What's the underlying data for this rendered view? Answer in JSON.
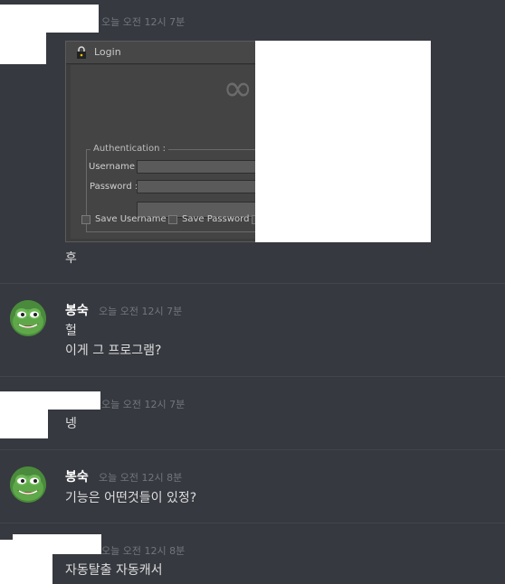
{
  "messages": [
    {
      "timestamp": "오늘 오전 12시 7분",
      "attachment": {
        "window_title": "Login",
        "logo_glyph": "∞",
        "group_label": "Authentication :",
        "username_label": "Username :",
        "password_label": "Password :",
        "checkboxes": [
          "Save Username",
          "Save Password"
        ]
      },
      "lines": [
        "후"
      ]
    },
    {
      "author": "봉숙",
      "timestamp": "오늘 오전 12시 7분",
      "lines": [
        "헐",
        "이게 그 프로그램?"
      ]
    },
    {
      "timestamp": "오늘 오전 12시 7분",
      "lines": [
        "넹"
      ]
    },
    {
      "author": "봉숙",
      "timestamp": "오늘 오전 12시 8분",
      "lines": [
        "기능은 어떤것들이 있정?"
      ]
    },
    {
      "timestamp": "오늘 오전 12시 8분",
      "lines": [
        "자동탈출 자동캐서"
      ]
    }
  ],
  "colors": {
    "background": "#36393f",
    "timestamp": "#72767d",
    "message_text": "#dcddde",
    "author": "#ffffff"
  },
  "icons": {
    "avatar": "frog-avatar-icon",
    "window": "lock-icon"
  }
}
